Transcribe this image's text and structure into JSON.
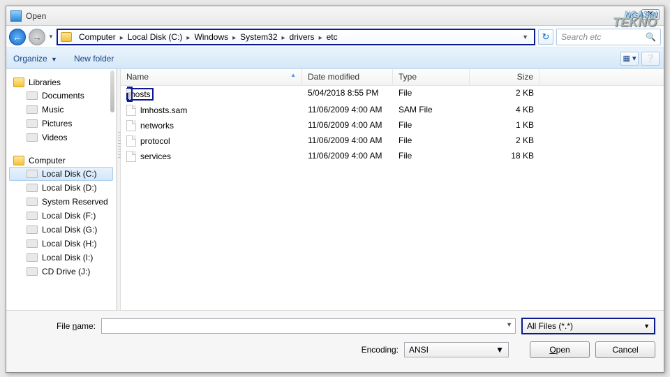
{
  "window": {
    "title": "Open"
  },
  "breadcrumb": [
    "Computer",
    "Local Disk (C:)",
    "Windows",
    "System32",
    "drivers",
    "etc"
  ],
  "search": {
    "placeholder": "Search etc"
  },
  "toolbar": {
    "organize": "Organize",
    "newfolder": "New folder"
  },
  "nav": {
    "libraries": {
      "label": "Libraries",
      "items": [
        "Documents",
        "Music",
        "Pictures",
        "Videos"
      ]
    },
    "computer": {
      "label": "Computer",
      "items": [
        "Local Disk (C:)",
        "Local Disk (D:)",
        "System Reserved",
        "Local Disk (F:)",
        "Local Disk (G:)",
        "Local Disk (H:)",
        "Local Disk (I:)",
        "CD Drive (J:)"
      ],
      "selected": 0
    }
  },
  "columns": {
    "name": "Name",
    "date": "Date modified",
    "type": "Type",
    "size": "Size"
  },
  "files": [
    {
      "name": "hosts",
      "date": "5/04/2018 8:55 PM",
      "type": "File",
      "size": "2 KB",
      "highlight": true
    },
    {
      "name": "lmhosts.sam",
      "date": "11/06/2009 4:00 AM",
      "type": "SAM File",
      "size": "4 KB"
    },
    {
      "name": "networks",
      "date": "11/06/2009 4:00 AM",
      "type": "File",
      "size": "1 KB"
    },
    {
      "name": "protocol",
      "date": "11/06/2009 4:00 AM",
      "type": "File",
      "size": "2 KB"
    },
    {
      "name": "services",
      "date": "11/06/2009 4:00 AM",
      "type": "File",
      "size": "18 KB"
    }
  ],
  "footer": {
    "filename_label": "File name:",
    "filename_value": "",
    "filter": "All Files  (*.*)",
    "encoding_label": "Encoding:",
    "encoding_value": "ANSI",
    "open": "Open",
    "cancel": "Cancel"
  },
  "watermark": {
    "l1": "NGASIN",
    "l2": "TEKNO"
  }
}
